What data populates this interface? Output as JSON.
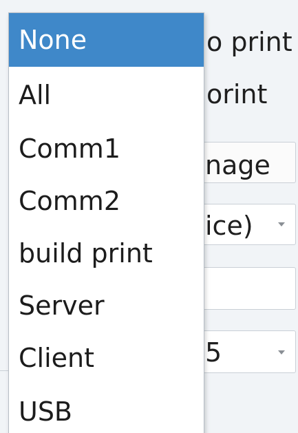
{
  "background": {
    "row1_text": "o print",
    "row2_text": "orint",
    "manage_button_label": "nage",
    "device_select_value": "ice)",
    "input_value": "",
    "number_select_value": "5"
  },
  "dropdown": {
    "selected": "None",
    "options": [
      {
        "label": "None"
      },
      {
        "label": "All"
      },
      {
        "label": "Comm1"
      },
      {
        "label": "Comm2"
      },
      {
        "label": "build print"
      },
      {
        "label": "Server"
      },
      {
        "label": "Client"
      },
      {
        "label": "USB"
      }
    ]
  },
  "colors": {
    "selected_bg": "#3f88c9",
    "selected_text": "#ffffff"
  }
}
